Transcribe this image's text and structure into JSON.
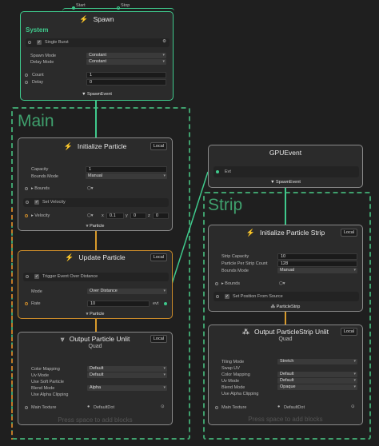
{
  "graph_inputs": {
    "start": "Start",
    "stop": "Stop"
  },
  "spawn": {
    "title": "Spawn",
    "system_label": "System",
    "single_burst": "Single Burst",
    "spawn_mode_label": "Spawn Mode",
    "spawn_mode": "Constant",
    "delay_mode_label": "Delay Mode",
    "delay_mode": "Constant",
    "count_label": "Count",
    "count": "1",
    "delay_label": "Delay",
    "delay": "0",
    "output": "SpawnEvent"
  },
  "main_context": {
    "label": "Main"
  },
  "strip_context": {
    "label": "Strip"
  },
  "init": {
    "title": "Initialize Particle",
    "badge": "Local",
    "capacity_label": "Capacity",
    "capacity": "1",
    "bounds_mode_label": "Bounds Mode",
    "bounds_mode": "Manual",
    "bounds_label": "Bounds",
    "set_label": "Set",
    "velocity_label": "Velocity",
    "velocity_row": "Velocity",
    "vx": "0.1",
    "vy": "0",
    "vz": "0",
    "output": "Particle"
  },
  "update": {
    "title": "Update Particle",
    "badge": "Local",
    "trigger_label": "Trigger Event",
    "trigger_over": "Over Distance",
    "mode_label": "Mode",
    "mode": "Over Distance",
    "rate_label": "Rate",
    "rate": "10",
    "evt": "evt",
    "output": "Particle"
  },
  "output_particle": {
    "title": "Output Particle",
    "subtitle_unlit": "Unlit",
    "subtitle": "Quad",
    "badge": "Local",
    "color_mapping_label": "Color Mapping",
    "color_mapping": "Default",
    "uv_mode_label": "Uv Mode",
    "uv_mode": "Default",
    "soft_particle_label": "Use Soft Particle",
    "blend_mode_label": "Blend Mode",
    "blend_mode": "Alpha",
    "alpha_clipping_label": "Use Alpha Clipping",
    "main_texture_label": "Main Texture",
    "main_texture": "DefaultDot",
    "hint": "Press space to add blocks"
  },
  "gpu_event": {
    "title": "GPUEvent",
    "evt_label": "Evt",
    "output": "SpawnEvent"
  },
  "init_strip": {
    "title": "Initialize Particle Strip",
    "badge": "Local",
    "strip_capacity_label": "Strip Capacity",
    "strip_capacity": "10",
    "per_strip_label": "Particle Per Strip Count",
    "per_strip": "128",
    "bounds_mode_label": "Bounds Mode",
    "bounds_mode": "Manual",
    "bounds_label": "Bounds",
    "set_label": "Set",
    "position_label": "Position",
    "from_source": "From Source",
    "output": "ParticleStrip"
  },
  "output_strip": {
    "title": "Output ParticleStrip",
    "subtitle_unlit": "Unlit",
    "subtitle": "Quad",
    "badge": "Local",
    "tiling_mode_label": "Tiling Mode",
    "tiling_mode": "Stretch",
    "swap_uv_label": "Swap UV",
    "color_mapping_label": "Color Mapping",
    "color_mapping": "Default",
    "uv_mode_label": "Uv Mode",
    "uv_mode": "Default",
    "blend_mode_label": "Blend Mode",
    "blend_mode": "Opaque",
    "alpha_clipping_label": "Use Alpha Clipping",
    "main_texture_label": "Main Texture",
    "main_texture": "DefaultDot",
    "hint": "Press space to add blocks"
  }
}
